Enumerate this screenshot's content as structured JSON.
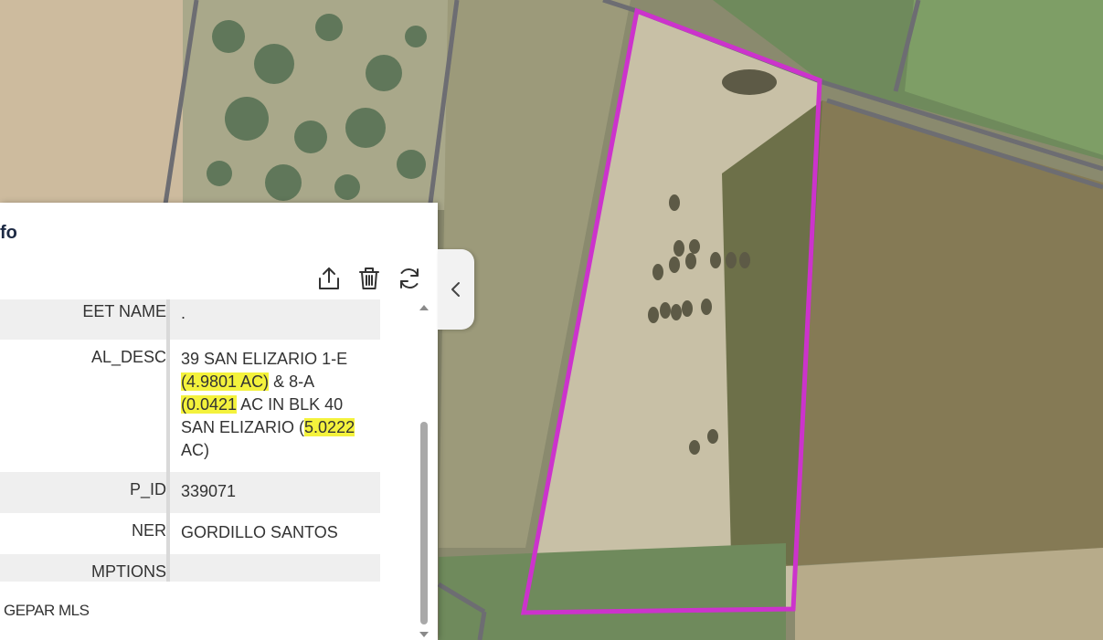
{
  "panel": {
    "title": "fo",
    "footer_text": "GEPAR MLS"
  },
  "toolbar": {
    "icons": [
      "share-icon",
      "trash-icon",
      "refresh-icon"
    ]
  },
  "attributes": [
    {
      "key": "EET NAME",
      "value": "."
    },
    {
      "key": "AL_DESC",
      "value_parts": [
        "39 SAN ",
        "ELIZARIO 1-E",
        "(4.9801 AC)",
        " & 8-A",
        "(0.0421",
        " AC IN BLK 40",
        "SAN ELIZARIO (",
        "5.0222",
        "AC)"
      ]
    },
    {
      "key": "P_ID",
      "value": "339071"
    },
    {
      "key": "NER",
      "value": "GORDILLO SANTOS"
    },
    {
      "key": "MPTIONS",
      "value": ""
    }
  ],
  "colors": {
    "parcel_outline": "#cc33cc",
    "highlight": "#f4f23c",
    "title": "#1d2a44"
  }
}
